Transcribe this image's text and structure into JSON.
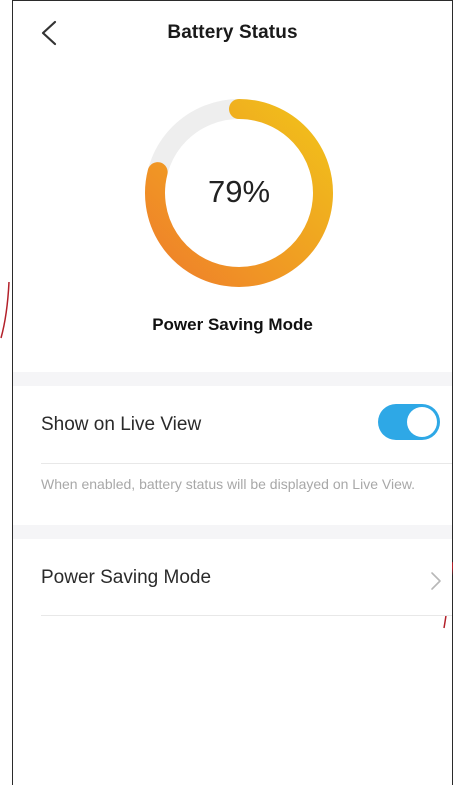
{
  "header": {
    "title": "Battery Status"
  },
  "battery": {
    "percent_label": "79%",
    "level": 0.79,
    "gradient_start": "#f1c21a",
    "gradient_end": "#ef7f2a",
    "track_color": "#eeeeee"
  },
  "mode": {
    "label": "Power Saving Mode"
  },
  "settings": {
    "show_on_live_view": {
      "label": "Show on Live View",
      "enabled": true,
      "toggle_color": "#2ea8e6"
    },
    "hint": "When enabled, battery status will be displayed on Live View.",
    "power_saving_row": {
      "label": "Power Saving Mode"
    }
  },
  "icons": {
    "back": "chevron-left-icon",
    "row_chevron": "chevron-right-icon"
  }
}
